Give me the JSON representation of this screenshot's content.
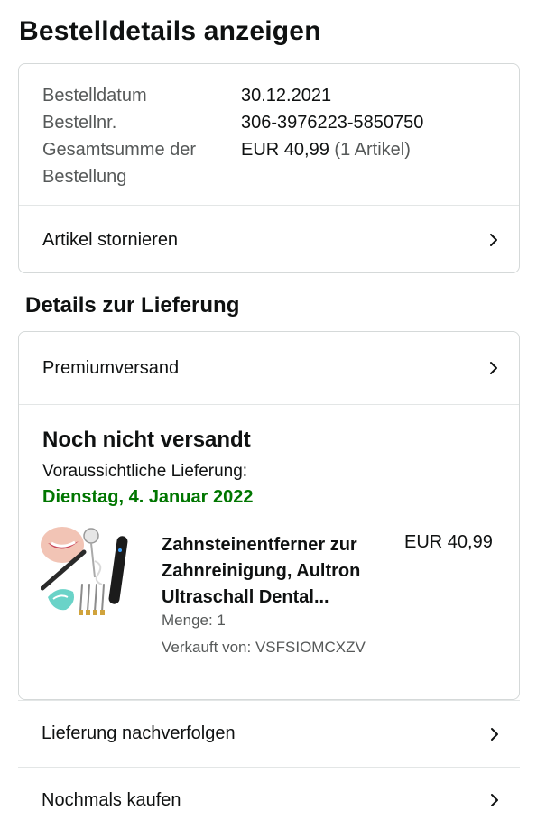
{
  "page": {
    "title": "Bestelldetails anzeigen"
  },
  "summary": {
    "date_label": "Bestelldatum",
    "date_value": "30.12.2021",
    "order_label": "Bestellnr.",
    "order_value": "306-3976223-5850750",
    "total_label_line1": "Gesamtsumme der",
    "total_label_line2": "Bestellung",
    "total_value": "EUR 40,99",
    "total_items": "(1 Artikel)",
    "cancel_label": "Artikel stornieren"
  },
  "delivery": {
    "section_title": "Details zur Lieferung",
    "shipping_method": "Premiumversand",
    "status": "Noch nicht versandt",
    "eta_label": "Voraussichtliche Lieferung:",
    "eta_date": "Dienstag, 4. Januar 2022"
  },
  "product": {
    "title": "Zahnsteinentferner zur Zahnreinigung, Aultron Ultraschall Dental...",
    "price": "EUR 40,99",
    "quantity": "Menge: 1",
    "seller": "Verkauft von: VSFSIOMCXZV"
  },
  "actions": {
    "track": "Lieferung nachverfolgen",
    "buy_again": "Nochmals kaufen"
  },
  "colors": {
    "eta_green": "#007600",
    "border": "#d5d9d9",
    "muted_text": "#565959"
  },
  "icons": {
    "chevron": "chevron-right-icon"
  }
}
